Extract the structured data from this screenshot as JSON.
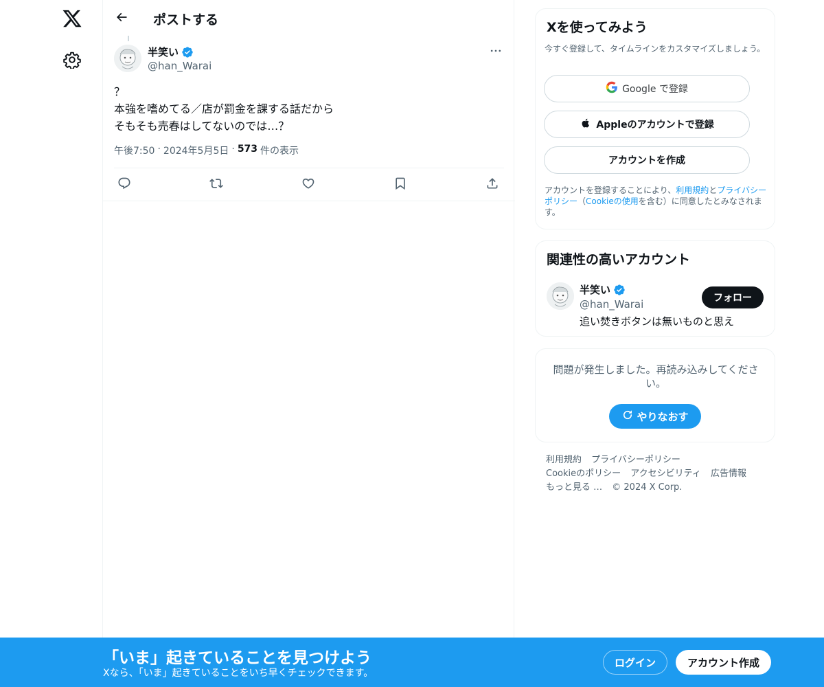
{
  "header": {
    "title": "ポストする"
  },
  "post": {
    "author_name": "半笑い",
    "author_handle": "@han_Warai",
    "text_lines": [
      "？",
      "本強を嗜めてる／店が罰金を課する話だから",
      "そもそも売春はしてないのでは…？"
    ],
    "time": "午後7:50",
    "date": "2024年5月5日",
    "views_count": "573",
    "views_label": "件の表示",
    "separator": "·"
  },
  "sidebar": {
    "join": {
      "title": "Xを使ってみよう",
      "subtitle": "今すぐ登録して、タイムラインをカスタマイズしましょう。",
      "google_label": "Google で登録",
      "apple_label": "Appleのアカウントで登録",
      "create_label": "アカウントを作成",
      "terms_prefix": "アカウントを登録することにより、",
      "terms_link": "利用規約",
      "terms_and": "と",
      "privacy_link": "プライバシーポリシー",
      "paren_open": "（",
      "cookie_link": "Cookieの使用",
      "terms_suffix": "を含む）に同意したとみなされます。"
    },
    "related": {
      "title": "関連性の高いアカウント",
      "name": "半笑い",
      "handle": "@han_Warai",
      "bio": "追い焚きボタンは無いものと思え",
      "follow_label": "フォロー"
    },
    "error": {
      "message": "問題が発生しました。再読み込みしてください。",
      "retry_label": "やりなおす"
    },
    "footer": {
      "terms": "利用規約",
      "privacy": "プライバシーポリシー",
      "cookie": "Cookieのポリシー",
      "accessibility": "アクセシビリティ",
      "ads": "広告情報",
      "more": "もっと見る …",
      "copyright": "© 2024 X Corp."
    }
  },
  "banner": {
    "title": "「いま」起きていることを見つけよう",
    "subtitle": "Xなら、「いま」起きていることをいち早くチェックできます。",
    "login_label": "ログイン",
    "signup_label": "アカウント作成"
  },
  "colors": {
    "accent": "#1d9bf0",
    "text": "#0f1419",
    "secondary": "#536471",
    "border": "#eff3f4"
  },
  "icons": [
    "x-logo-icon",
    "gear-icon",
    "back-arrow-icon",
    "verified-badge-icon",
    "more-icon",
    "reply-icon",
    "repost-icon",
    "like-icon",
    "bookmark-icon",
    "share-icon",
    "google-icon",
    "apple-icon",
    "refresh-icon"
  ]
}
